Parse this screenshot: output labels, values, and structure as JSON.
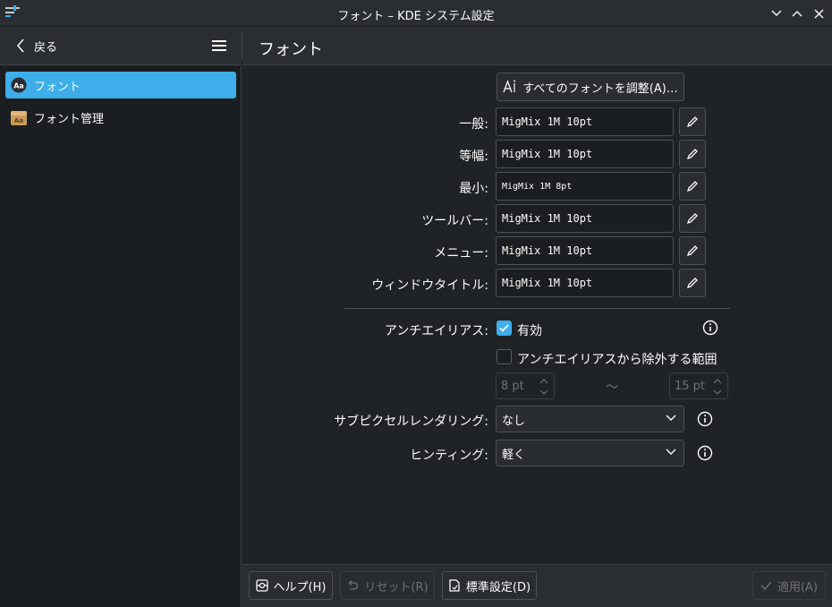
{
  "window": {
    "title": "フォント – KDE システム設定"
  },
  "header": {
    "back_label": "戻る",
    "page_title": "フォント"
  },
  "sidebar": {
    "items": [
      {
        "label": "フォント",
        "icon": "font-icon",
        "active": true
      },
      {
        "label": "フォント管理",
        "icon": "font-manager-icon",
        "active": false
      }
    ]
  },
  "main": {
    "adjust_all_label": "すべてのフォントを調整(A)…",
    "fonts": [
      {
        "label": "一般:",
        "value": "MigMix 1M 10pt"
      },
      {
        "label": "等幅:",
        "value": "MigMix 1M 10pt"
      },
      {
        "label": "最小:",
        "value": "MigMix 1M 8pt"
      },
      {
        "label": "ツールバー:",
        "value": "MigMix 1M 10pt"
      },
      {
        "label": "メニュー:",
        "value": "MigMix 1M 10pt"
      },
      {
        "label": "ウィンドウタイトル:",
        "value": "MigMix 1M 10pt"
      }
    ],
    "antialias": {
      "label": "アンチエイリアス:",
      "enabled_label": "有効",
      "enabled": true,
      "exclude_label": "アンチエイリアスから除外する範囲",
      "exclude": false,
      "range_from": "8 pt",
      "range_sep": "～",
      "range_to": "15 pt"
    },
    "subpixel": {
      "label": "サブピクセルレンダリング:",
      "value": "なし"
    },
    "hinting": {
      "label": "ヒンティング:",
      "value": "軽く"
    }
  },
  "footer": {
    "help_label": "ヘルプ(H)",
    "reset_label": "リセット(R)",
    "defaults_label": "標準設定(D)",
    "apply_label": "適用(A)"
  },
  "colors": {
    "accent": "#3daee9",
    "window_bg": "#202326",
    "sidebar_bg": "#1b1e20",
    "disabled_text": "#6e7175"
  }
}
